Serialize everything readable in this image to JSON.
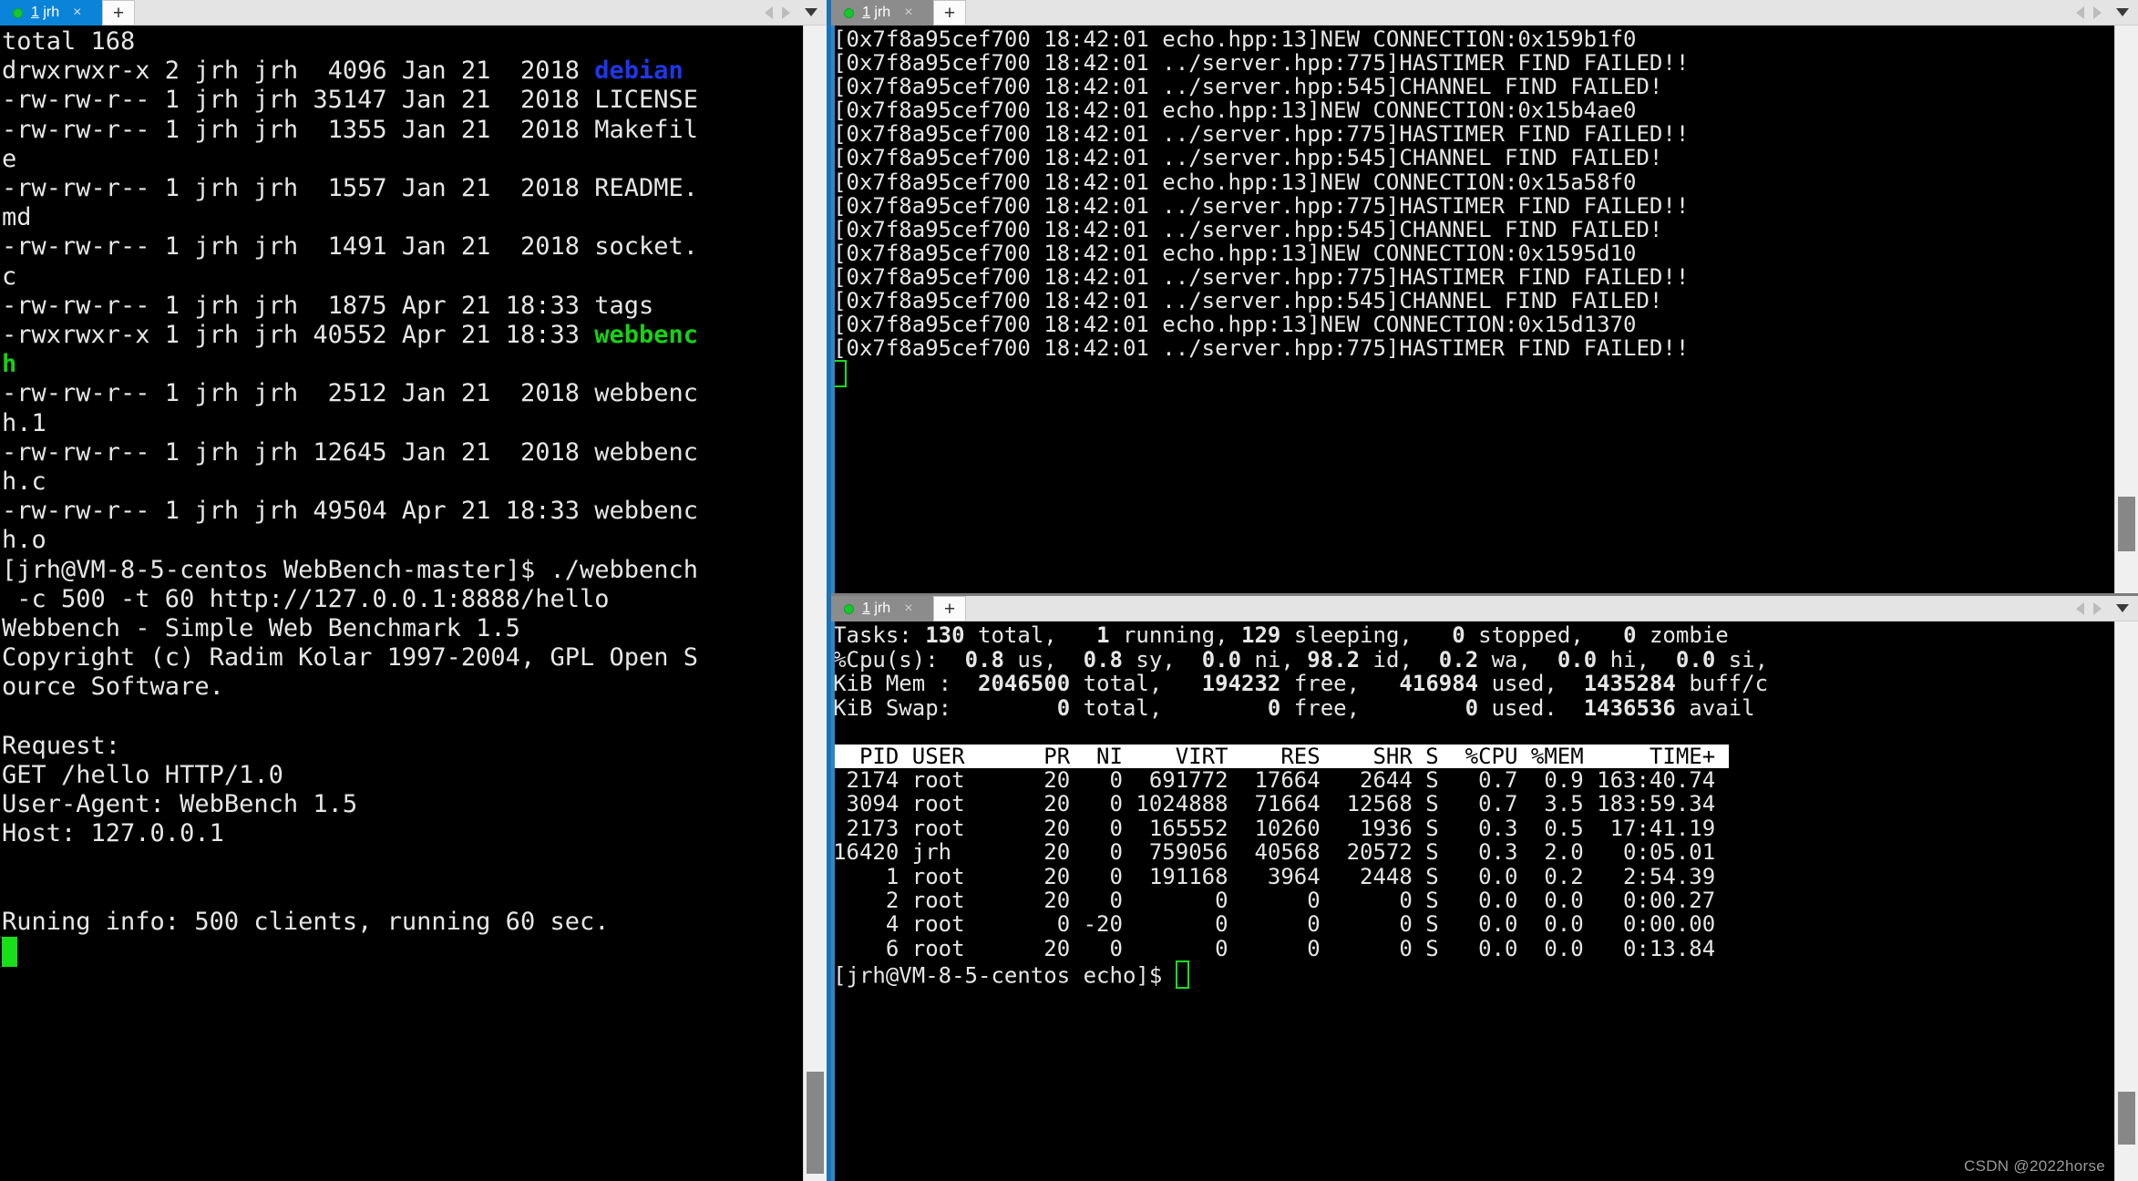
{
  "app": {
    "watermark": "CSDN @2022horse"
  },
  "panes": {
    "left": {
      "tab": {
        "number": "1",
        "name": "jrh",
        "close_label": "×",
        "new_tab_label": "+",
        "status_dot_color": "#16c72e",
        "active": true
      },
      "terminal_lines": [
        {
          "text": "total 168"
        },
        {
          "segments": [
            {
              "t": "drwxrwxr-x 2 jrh jrh  4096 Jan 21  2018 "
            },
            {
              "t": "debian",
              "c": "blue"
            }
          ]
        },
        {
          "text": "-rw-rw-r-- 1 jrh jrh 35147 Jan 21  2018 LICENSE"
        },
        {
          "text": "-rw-rw-r-- 1 jrh jrh  1355 Jan 21  2018 Makefil"
        },
        {
          "text": "e"
        },
        {
          "text": "-rw-rw-r-- 1 jrh jrh  1557 Jan 21  2018 README."
        },
        {
          "text": "md"
        },
        {
          "text": "-rw-rw-r-- 1 jrh jrh  1491 Jan 21  2018 socket."
        },
        {
          "text": "c"
        },
        {
          "text": "-rw-rw-r-- 1 jrh jrh  1875 Apr 21 18:33 tags"
        },
        {
          "segments": [
            {
              "t": "-rwxrwxr-x 1 jrh jrh 40552 Apr 21 18:33 "
            },
            {
              "t": "webbenc",
              "c": "green"
            }
          ]
        },
        {
          "segments": [
            {
              "t": "h",
              "c": "green"
            }
          ]
        },
        {
          "text": "-rw-rw-r-- 1 jrh jrh  2512 Jan 21  2018 webbenc"
        },
        {
          "text": "h.1"
        },
        {
          "text": "-rw-rw-r-- 1 jrh jrh 12645 Jan 21  2018 webbenc"
        },
        {
          "text": "h.c"
        },
        {
          "text": "-rw-rw-r-- 1 jrh jrh 49504 Apr 21 18:33 webbenc"
        },
        {
          "text": "h.o"
        },
        {
          "text": "[jrh@VM-8-5-centos WebBench-master]$ ./webbench"
        },
        {
          "text": " -c 500 -t 60 http://127.0.0.1:8888/hello"
        },
        {
          "text": "Webbench - Simple Web Benchmark 1.5"
        },
        {
          "text": "Copyright (c) Radim Kolar 1997-2004, GPL Open S"
        },
        {
          "text": "ource Software."
        },
        {
          "text": ""
        },
        {
          "text": "Request:"
        },
        {
          "text": "GET /hello HTTP/1.0"
        },
        {
          "text": "User-Agent: WebBench 1.5"
        },
        {
          "text": "Host: 127.0.0.1"
        },
        {
          "text": ""
        },
        {
          "text": ""
        },
        {
          "text": "Runing info: 500 clients, running 60 sec."
        },
        {
          "cursor": "block"
        }
      ]
    },
    "right_top": {
      "tab": {
        "number": "1",
        "name": "jrh",
        "close_label": "×",
        "new_tab_label": "+",
        "status_dot_color": "#16c72e",
        "active": false
      },
      "terminal_lines": [
        {
          "text": "[0x7f8a95cef700 18:42:01 echo.hpp:13]NEW CONNECTION:0x159b1f0"
        },
        {
          "text": "[0x7f8a95cef700 18:42:01 ../server.hpp:775]HASTIMER FIND FAILED!!"
        },
        {
          "text": "[0x7f8a95cef700 18:42:01 ../server.hpp:545]CHANNEL FIND FAILED!"
        },
        {
          "text": "[0x7f8a95cef700 18:42:01 echo.hpp:13]NEW CONNECTION:0x15b4ae0"
        },
        {
          "text": "[0x7f8a95cef700 18:42:01 ../server.hpp:775]HASTIMER FIND FAILED!!"
        },
        {
          "text": "[0x7f8a95cef700 18:42:01 ../server.hpp:545]CHANNEL FIND FAILED!"
        },
        {
          "text": "[0x7f8a95cef700 18:42:01 echo.hpp:13]NEW CONNECTION:0x15a58f0"
        },
        {
          "text": "[0x7f8a95cef700 18:42:01 ../server.hpp:775]HASTIMER FIND FAILED!!"
        },
        {
          "text": "[0x7f8a95cef700 18:42:01 ../server.hpp:545]CHANNEL FIND FAILED!"
        },
        {
          "text": "[0x7f8a95cef700 18:42:01 echo.hpp:13]NEW CONNECTION:0x1595d10"
        },
        {
          "text": "[0x7f8a95cef700 18:42:01 ../server.hpp:775]HASTIMER FIND FAILED!!"
        },
        {
          "text": "[0x7f8a95cef700 18:42:01 ../server.hpp:545]CHANNEL FIND FAILED!"
        },
        {
          "text": "[0x7f8a95cef700 18:42:01 echo.hpp:13]NEW CONNECTION:0x15d1370"
        },
        {
          "text": "[0x7f8a95cef700 18:42:01 ../server.hpp:775]HASTIMER FIND FAILED!!"
        },
        {
          "cursor": "hollow"
        }
      ]
    },
    "right_bottom": {
      "tab": {
        "number": "1",
        "name": "jrh",
        "close_label": "×",
        "new_tab_label": "+",
        "status_dot_color": "#16c72e",
        "active": false
      },
      "top_summary": [
        {
          "segments": [
            {
              "t": "Tasks: "
            },
            {
              "t": "130",
              "c": "bold"
            },
            {
              "t": " total,   "
            },
            {
              "t": "1",
              "c": "bold"
            },
            {
              "t": " running, "
            },
            {
              "t": "129",
              "c": "bold"
            },
            {
              "t": " sleeping,   "
            },
            {
              "t": "0",
              "c": "bold"
            },
            {
              "t": " stopped,   "
            },
            {
              "t": "0",
              "c": "bold"
            },
            {
              "t": " zombie"
            }
          ]
        },
        {
          "segments": [
            {
              "t": "%Cpu(s):  "
            },
            {
              "t": "0.8",
              "c": "bold"
            },
            {
              "t": " us,  "
            },
            {
              "t": "0.8",
              "c": "bold"
            },
            {
              "t": " sy,  "
            },
            {
              "t": "0.0",
              "c": "bold"
            },
            {
              "t": " ni, "
            },
            {
              "t": "98.2",
              "c": "bold"
            },
            {
              "t": " id,  "
            },
            {
              "t": "0.2",
              "c": "bold"
            },
            {
              "t": " wa,  "
            },
            {
              "t": "0.0",
              "c": "bold"
            },
            {
              "t": " hi,  "
            },
            {
              "t": "0.0",
              "c": "bold"
            },
            {
              "t": " si,"
            }
          ]
        },
        {
          "segments": [
            {
              "t": "KiB Mem :  "
            },
            {
              "t": "2046500",
              "c": "bold"
            },
            {
              "t": " total,   "
            },
            {
              "t": "194232",
              "c": "bold"
            },
            {
              "t": " free,   "
            },
            {
              "t": "416984",
              "c": "bold"
            },
            {
              "t": " used,  "
            },
            {
              "t": "1435284",
              "c": "bold"
            },
            {
              "t": " buff/c"
            }
          ]
        },
        {
          "segments": [
            {
              "t": "KiB Swap:        "
            },
            {
              "t": "0",
              "c": "bold"
            },
            {
              "t": " total,        "
            },
            {
              "t": "0",
              "c": "bold"
            },
            {
              "t": " free,        "
            },
            {
              "t": "0",
              "c": "bold"
            },
            {
              "t": " used.  "
            },
            {
              "t": "1436536",
              "c": "bold"
            },
            {
              "t": " avail"
            }
          ]
        }
      ],
      "table_header": "  PID USER      PR  NI    VIRT    RES    SHR S  %CPU %MEM     TIME+ ",
      "table_rows": [
        " 2174 root      20   0  691772  17664   2644 S   0.7  0.9 163:40.74",
        " 3094 root      20   0 1024888  71664  12568 S   0.7  3.5 183:59.34",
        " 2173 root      20   0  165552  10260   1936 S   0.3  0.5  17:41.19",
        "16420 jrh       20   0  759056  40568  20572 S   0.3  2.0   0:05.01",
        "    1 root      20   0  191168   3964   2448 S   0.0  0.2   2:54.39",
        "    2 root      20   0       0      0      0 S   0.0  0.0   0:00.27",
        "    4 root       0 -20       0      0      0 S   0.0  0.0   0:00.00",
        "    6 root      20   0       0      0      0 S   0.0  0.0   0:13.84"
      ],
      "prompt": "[jrh@VM-8-5-centos echo]$ "
    }
  }
}
